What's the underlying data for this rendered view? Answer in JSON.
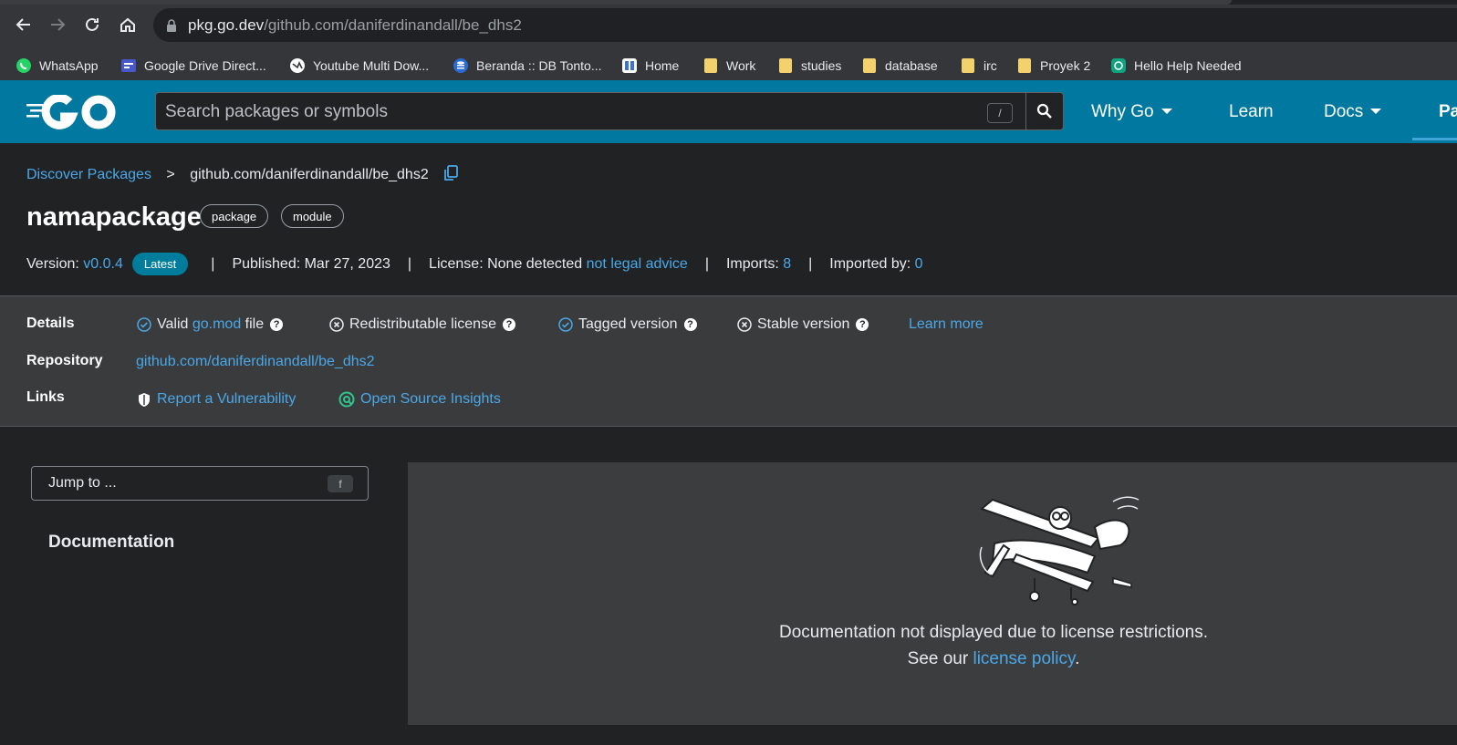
{
  "browser": {
    "url_host": "pkg.go.dev",
    "url_path": "/github.com/daniferdinandall/be_dhs2",
    "bookmarks": [
      {
        "label": "WhatsApp",
        "icon": "whatsapp-icon"
      },
      {
        "label": "Google Drive Direct...",
        "icon": "drive-direct-icon"
      },
      {
        "label": "Youtube Multi Dow...",
        "icon": "globe-icon"
      },
      {
        "label": "Beranda :: DB Tonto...",
        "icon": "database-icon"
      },
      {
        "label": "Home",
        "icon": "home-app-icon"
      },
      {
        "label": "Work",
        "icon": "folder-icon"
      },
      {
        "label": "studies",
        "icon": "folder-icon"
      },
      {
        "label": "database",
        "icon": "folder-icon"
      },
      {
        "label": "irc",
        "icon": "folder-icon"
      },
      {
        "label": "Proyek 2",
        "icon": "folder-icon"
      },
      {
        "label": "Hello Help Needed",
        "icon": "openai-icon"
      }
    ]
  },
  "header": {
    "search_placeholder": "Search packages or symbols",
    "search_shortcut": "/",
    "nav": {
      "why_go": "Why Go",
      "learn": "Learn",
      "docs": "Docs",
      "packages_partial": "Pa"
    },
    "brand_color": "#00789f"
  },
  "breadcrumb": {
    "root": "Discover Packages",
    "separator": ">",
    "current": "github.com/daniferdinandall/be_dhs2"
  },
  "package": {
    "name": "namapackage",
    "tags": [
      "package",
      "module"
    ],
    "meta": {
      "version_label": "Version:",
      "version": "v0.0.4",
      "latest_badge": "Latest",
      "published_label": "Published: Mar 27, 2023",
      "license_label": "License: None detected",
      "license_link": "not legal advice",
      "imports_label": "Imports:",
      "imports_count": "8",
      "imported_by_label": "Imported by:",
      "imported_by_count": "0",
      "separator": "|"
    }
  },
  "details": {
    "details_label": "Details",
    "checks": {
      "valid_prefix": "Valid",
      "valid_link": "go.mod",
      "valid_suffix": "file",
      "redistributable": "Redistributable license",
      "tagged": "Tagged version",
      "stable": "Stable version",
      "learn_more": "Learn more"
    },
    "repository_label": "Repository",
    "repository_url": "github.com/daniferdinandall/be_dhs2",
    "links_label": "Links",
    "report_vuln": "Report a Vulnerability",
    "open_source_insights": "Open Source Insights"
  },
  "sidebar": {
    "jump_placeholder": "Jump to ...",
    "jump_shortcut": "f",
    "documentation_heading": "Documentation"
  },
  "main": {
    "message_line1": "Documentation not displayed due to license restrictions.",
    "message_see": "See our",
    "message_link": "license policy",
    "message_end": "."
  }
}
